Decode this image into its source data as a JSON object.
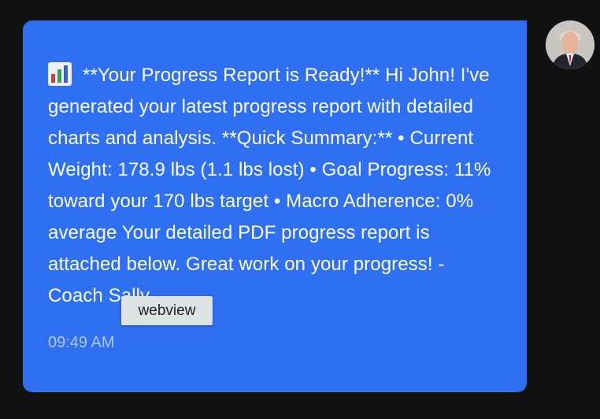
{
  "message": {
    "icon": "bar-chart-icon",
    "text": "**Your Progress Report is Ready!** Hi John! I've generated your latest progress report with detailed charts and analysis. **Quick Summary:** • Current Weight: 178.9 lbs (1.1 lbs lost) • Goal Progress: 11% toward your 170 lbs target • Macro Adherence: 0% average Your detailed PDF progress report is attached below. Great work on your progress! - Coach Sally",
    "timestamp": "09:49 AM"
  },
  "tooltip": {
    "label": "webview"
  },
  "avatar": {
    "icon": "user-avatar"
  },
  "colors": {
    "background": "#121212",
    "bubble": "#2f6ff2",
    "text": "#ffffff",
    "tooltip_bg": "#dde3e2"
  }
}
